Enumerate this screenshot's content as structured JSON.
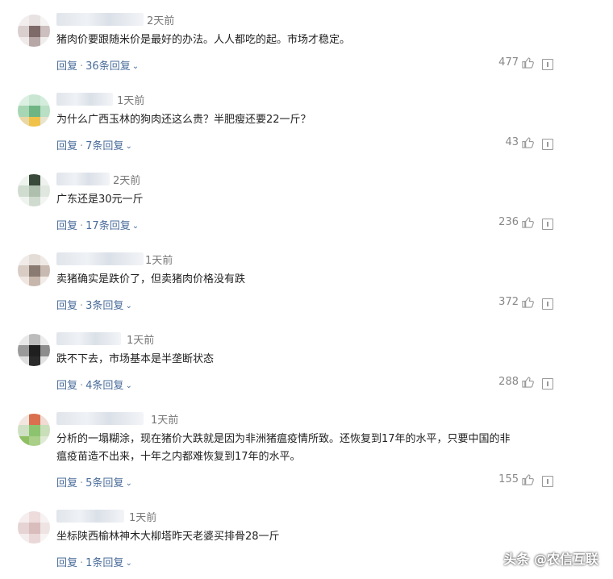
{
  "comments": [
    {
      "time": "2天前",
      "text": "猪肉价要跟随米价是最好的办法。人人都吃的起。市场才稳定。",
      "reply_label": "回复",
      "sep": "·",
      "replies": "36条回复",
      "likes": "477"
    },
    {
      "time": "1天前",
      "text": "为什么广西玉林的狗肉还这么贵？半肥瘦还要22一斤？",
      "reply_label": "回复",
      "sep": "·",
      "replies": "7条回复",
      "likes": "43"
    },
    {
      "time": "2天前",
      "text": "广东还是30元一斤",
      "reply_label": "回复",
      "sep": "·",
      "replies": "17条回复",
      "likes": "236"
    },
    {
      "time": "1天前",
      "text": "卖猪确实是跌价了，但卖猪肉价格没有跌",
      "reply_label": "回复",
      "sep": "·",
      "replies": "3条回复",
      "likes": "372"
    },
    {
      "time": "1天前",
      "text": "跌不下去，市场基本是半垄断状态",
      "reply_label": "回复",
      "sep": "·",
      "replies": "4条回复",
      "likes": "288"
    },
    {
      "time": "1天前",
      "text_line1": "分析的一塌糊涂，现在猪价大跌就是因为非洲猪瘟疫情所致。还恢复到17年的水平，只要中国的非",
      "text_line2": "瘟疫苗造不出来，十年之内都难恢复到17年的水平。",
      "reply_label": "回复",
      "sep": "·",
      "replies": "5条回复",
      "likes": "155"
    },
    {
      "time": "1天前",
      "text": "坐标陕西榆林神木大柳塔昨天老婆买排骨28一斤",
      "reply_label": "回复",
      "sep": "·",
      "replies": "1条回复",
      "likes": ""
    }
  ],
  "watermark": "头条 @农信互联",
  "icons": {
    "like": "thumbs-up-icon",
    "report": "report-icon",
    "expand": "chevron-down-icon"
  }
}
